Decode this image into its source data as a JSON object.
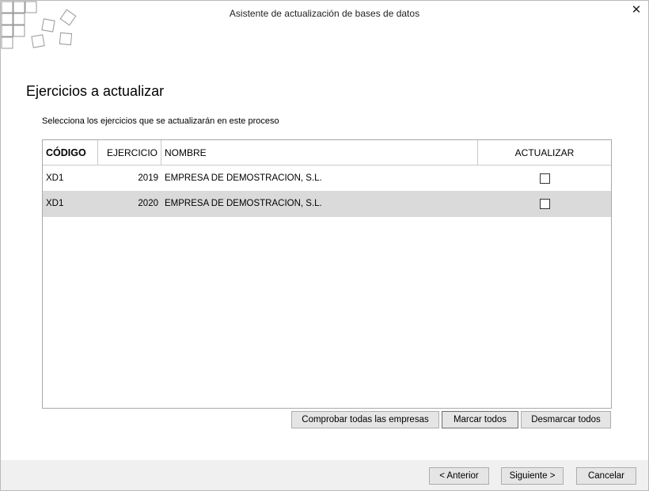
{
  "window": {
    "title": "Asistente de actualización de bases de datos",
    "close_glyph": "✕"
  },
  "page": {
    "heading": "Ejercicios a actualizar",
    "subtitle": "Selecciona los ejercicios que se actualizarán en este proceso"
  },
  "table": {
    "columns": [
      "CÓDIGO",
      "EJERCICIO",
      "NOMBRE",
      "ACTUALIZAR"
    ],
    "rows": [
      {
        "codigo": "XD1",
        "ejercicio": "2019",
        "nombre": "EMPRESA DE DEMOSTRACION, S.L.",
        "actualizar": false
      },
      {
        "codigo": "XD1",
        "ejercicio": "2020",
        "nombre": "EMPRESA DE DEMOSTRACION, S.L.",
        "actualizar": false,
        "selected": true
      }
    ]
  },
  "actions": {
    "check_all_companies": "Comprobar todas las empresas",
    "mark_all": "Marcar todos",
    "unmark_all": "Desmarcar todos"
  },
  "footer": {
    "back": "< Anterior",
    "next": "Siguiente >",
    "cancel": "Cancelar"
  },
  "colors": {
    "selected_row": "#dadada",
    "footer_bg": "#f0f0f0",
    "button_bg": "#e5e5e5"
  },
  "icons": {
    "logo": "tiles-logo-icon",
    "close": "close-icon"
  }
}
